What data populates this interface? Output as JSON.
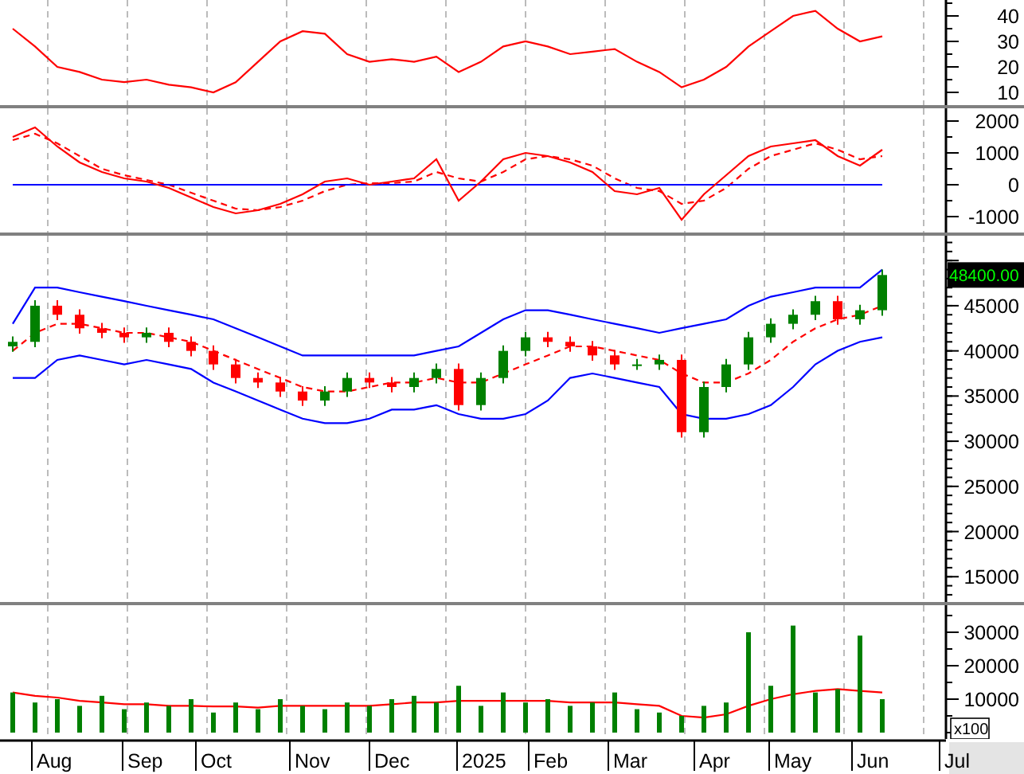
{
  "panels": [
    {
      "kind": "rsi",
      "chart_data": {
        "type": "line",
        "grid": true,
        "ylim": [
          5,
          46.25
        ],
        "yticks": [
          10,
          20,
          30,
          40
        ],
        "series": [
          {
            "color": "#ff0000",
            "values": [
              35,
              28,
              20,
              18,
              15,
              14,
              15,
              13,
              12,
              10,
              14,
              22,
              30,
              34,
              33,
              25,
              22,
              23,
              22,
              24,
              18,
              22,
              28,
              30,
              28,
              25,
              26,
              27,
              22,
              18,
              12,
              15,
              20,
              28,
              34,
              40,
              42,
              35,
              30,
              32
            ]
          }
        ]
      }
    },
    {
      "kind": "macd",
      "chart_data": {
        "type": "line",
        "grid": true,
        "ylim": [
          -1500,
          2400
        ],
        "yticks": [
          -1000,
          0,
          1000,
          2000
        ],
        "series": [
          {
            "color": "#ff0000",
            "values": [
              1500,
              1800,
              1200,
              700,
              400,
              200,
              100,
              -100,
              -400,
              -700,
              -900,
              -800,
              -600,
              -300,
              100,
              200,
              0,
              100,
              200,
              800,
              -500,
              100,
              800,
              1000,
              900,
              700,
              400,
              -200,
              -300,
              -100,
              -1100,
              -300,
              300,
              900,
              1200,
              1300,
              1400,
              900,
              600,
              1100
            ]
          },
          {
            "color": "#0000ff",
            "values": [
              0,
              0,
              0,
              0,
              0,
              0,
              0,
              0,
              0,
              0,
              0,
              0,
              0,
              0,
              0,
              0,
              0,
              0,
              0,
              0,
              0,
              0,
              0,
              0,
              0,
              0,
              0,
              0,
              0,
              0,
              0,
              0,
              0,
              0,
              0,
              0,
              0,
              0,
              0,
              0
            ]
          },
          {
            "color": "#ff0000",
            "line_style": "dashed",
            "values": [
              1400,
              1600,
              1300,
              900,
              500,
              300,
              150,
              0,
              -250,
              -500,
              -750,
              -800,
              -700,
              -500,
              -200,
              0,
              50,
              50,
              100,
              400,
              200,
              100,
              400,
              800,
              900,
              800,
              600,
              200,
              -100,
              -200,
              -600,
              -500,
              -100,
              500,
              900,
              1100,
              1300,
              1100,
              800,
              900
            ]
          }
        ]
      }
    },
    {
      "kind": "price",
      "price_tag": "48400.00",
      "chart_data": {
        "type": "candlestick",
        "grid": true,
        "ylim": [
          12200,
          52750
        ],
        "yticks": [
          15000,
          20000,
          25000,
          30000,
          35000,
          40000,
          45000
        ],
        "ohlc": [
          [
            40500,
            41600,
            39900,
            41000
          ],
          [
            41000,
            45600,
            40400,
            45000
          ],
          [
            45000,
            45600,
            43400,
            44000
          ],
          [
            44000,
            44600,
            41900,
            42500
          ],
          [
            42500,
            43100,
            41400,
            42000
          ],
          [
            42000,
            42600,
            40900,
            41500
          ],
          [
            41500,
            42600,
            40900,
            42000
          ],
          [
            42000,
            42600,
            40400,
            41000
          ],
          [
            41000,
            41600,
            39400,
            40000
          ],
          [
            40000,
            40600,
            37900,
            38500
          ],
          [
            38500,
            39100,
            36400,
            37000
          ],
          [
            37000,
            37600,
            35900,
            36500
          ],
          [
            36500,
            37100,
            34900,
            35500
          ],
          [
            35500,
            36100,
            33900,
            34500
          ],
          [
            34500,
            36100,
            33900,
            35500
          ],
          [
            35500,
            37600,
            34900,
            37000
          ],
          [
            37000,
            37600,
            35900,
            36500
          ],
          [
            36500,
            37100,
            35400,
            36000
          ],
          [
            36000,
            37600,
            35400,
            37000
          ],
          [
            37000,
            38600,
            36400,
            38000
          ],
          [
            38000,
            38600,
            33400,
            34000
          ],
          [
            34000,
            37600,
            33400,
            37000
          ],
          [
            37000,
            40600,
            36400,
            40000
          ],
          [
            40000,
            42100,
            39400,
            41500
          ],
          [
            41500,
            42100,
            40400,
            41000
          ],
          [
            41000,
            41600,
            39900,
            40500
          ],
          [
            40500,
            41100,
            38900,
            39500
          ],
          [
            39500,
            40100,
            37900,
            38500
          ],
          [
            38500,
            39100,
            37900,
            38500
          ],
          [
            38500,
            39600,
            37900,
            39000
          ],
          [
            39000,
            39600,
            30400,
            31000
          ],
          [
            31000,
            36600,
            30400,
            36000
          ],
          [
            36000,
            39100,
            35400,
            38500
          ],
          [
            38500,
            42100,
            37900,
            41500
          ],
          [
            41500,
            43600,
            40900,
            43000
          ],
          [
            43000,
            44600,
            42400,
            44000
          ],
          [
            44000,
            46100,
            43400,
            45500
          ],
          [
            45500,
            46100,
            42900,
            43500
          ],
          [
            43500,
            45100,
            42900,
            44500
          ],
          [
            44500,
            49000,
            43900,
            48400
          ]
        ],
        "series": [
          {
            "type": "line",
            "color": "#0000ff",
            "values": [
              43000,
              47000,
              47000,
              46500,
              46000,
              45500,
              45000,
              44500,
              44000,
              43500,
              42500,
              41500,
              40500,
              39500,
              39500,
              39500,
              39500,
              39500,
              39500,
              40000,
              40500,
              42000,
              43500,
              44500,
              44500,
              44000,
              43500,
              43000,
              42500,
              42000,
              42500,
              43000,
              43500,
              45000,
              46000,
              46500,
              47000,
              47000,
              47000,
              49000
            ]
          },
          {
            "type": "line",
            "color": "#ff0000",
            "line_style": "dashed",
            "values": [
              40000,
              42000,
              43000,
              43000,
              42500,
              42000,
              42000,
              41500,
              41000,
              40000,
              39000,
              38000,
              37000,
              36000,
              35500,
              35500,
              36000,
              36500,
              36500,
              37000,
              36500,
              36500,
              37500,
              38500,
              39500,
              40500,
              40500,
              40000,
              39500,
              39000,
              37500,
              36500,
              36500,
              37500,
              39000,
              41000,
              42500,
              43500,
              44000,
              45000
            ]
          },
          {
            "type": "line",
            "color": "#0000ff",
            "values": [
              37000,
              37000,
              39000,
              39500,
              39000,
              38500,
              39000,
              38500,
              38000,
              36500,
              35500,
              34500,
              33500,
              32500,
              32000,
              32000,
              32500,
              33500,
              33500,
              34000,
              33000,
              32500,
              32500,
              33000,
              34500,
              37000,
              37500,
              37000,
              36500,
              36000,
              33000,
              32500,
              32500,
              33000,
              34000,
              36000,
              38500,
              40000,
              41000,
              41500
            ]
          }
        ]
      }
    },
    {
      "kind": "volume",
      "unit": "x100",
      "chart_data": {
        "type": "bar",
        "grid": true,
        "ylim": [
          -1900,
          38100
        ],
        "yticks": [
          10000,
          20000,
          30000
        ],
        "series": [
          {
            "type": "bar",
            "color": "#008000",
            "values": [
              12000,
              9000,
              10000,
              8000,
              11000,
              7000,
              9000,
              8000,
              10000,
              6000,
              9000,
              7000,
              10000,
              8000,
              7000,
              9000,
              8000,
              10000,
              11000,
              9000,
              14000,
              8000,
              12000,
              9000,
              10000,
              8000,
              9000,
              12000,
              7000,
              6000,
              5000,
              8000,
              9000,
              30000,
              14000,
              32000,
              12000,
              13000,
              29000,
              10000
            ]
          },
          {
            "type": "line",
            "color": "#ff0000",
            "values": [
              12000,
              11000,
              10500,
              9500,
              9000,
              8500,
              8500,
              8000,
              8000,
              7800,
              7800,
              7500,
              8000,
              8000,
              8000,
              8000,
              8000,
              8500,
              9000,
              9000,
              9500,
              9500,
              9500,
              9500,
              9500,
              9000,
              9000,
              9000,
              8500,
              8000,
              5000,
              4500,
              5500,
              8000,
              10000,
              11500,
              12500,
              13000,
              12500,
              12000
            ]
          }
        ]
      }
    }
  ],
  "x_axis": {
    "labels": [
      "Aug",
      "Sep",
      "Oct",
      "Nov",
      "Dec",
      "2025",
      "Feb",
      "Mar",
      "Apr",
      "May",
      "Jun",
      "Jul"
    ]
  }
}
